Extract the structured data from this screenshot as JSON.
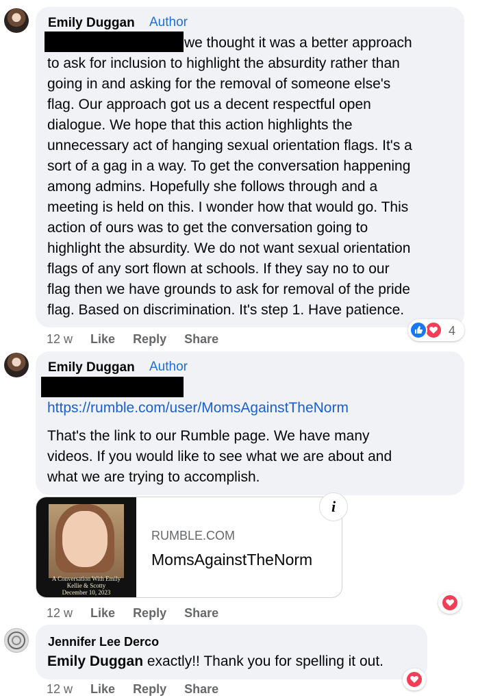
{
  "comments": [
    {
      "author": "Emily Duggan",
      "badge": "Author",
      "lines": [
        "we thought it was a better approach",
        "to ask for inclusion to highlight the absurdity rather than",
        "going in and asking for the removal of someone else's",
        "flag. Our approach got us a decent respectful open",
        "dialogue. We hope that this action highlights the",
        "unnecessary act of hanging sexual orientation flags. It's a",
        "sort of a gag in a way. To get the conversation happening",
        "among admins. Hopefully she follows through and a",
        "meeting is held on this. I wonder how that would go. This",
        "action of ours was to get the conversation going to",
        "highlight the absurdity. We do not want sexual orientation",
        "flags of any sort flown at schools. If they say no to our",
        "flag then we have grounds to ask for removal of the pride",
        "flag. Based on discrimination. It's step 1. Have patience."
      ],
      "time": "12 w",
      "like": "Like",
      "reply": "Reply",
      "share": "Share",
      "reaction_count": "4",
      "reactions": [
        "like-icon",
        "love-icon"
      ]
    },
    {
      "author": "Emily Duggan",
      "badge": "Author",
      "link": "https://rumble.com/user/MomsAgainstTheNorm",
      "lines": [
        "That's the link to our Rumble page. We have many",
        "videos. If you would like to see what we are about and",
        "what we are trying to accomplish."
      ],
      "card": {
        "domain": "RUMBLE.COM",
        "title": "MomsAgainstTheNorm",
        "thumb_caption": [
          "A Conversation With Emily",
          "Kellie & Scotty",
          "December 10, 2023"
        ],
        "info_glyph": "i"
      },
      "time": "12 w",
      "like": "Like",
      "reply": "Reply",
      "share": "Share",
      "reactions": [
        "love-icon"
      ]
    },
    {
      "author": "Jennifer Lee Derco",
      "mention": "Emily Duggan",
      "text": " exactly!! Thank you for spelling it out.",
      "time": "12 w",
      "like": "Like",
      "reply": "Reply",
      "share": "Share",
      "reactions": [
        "love-icon"
      ]
    }
  ],
  "colors": {
    "bubble": "#f0f2f5",
    "link": "#1a5fd0",
    "author_badge": "#1a6fd8",
    "meta": "#65676b",
    "like_blue": "#1877f2",
    "love_red": "#f33e58"
  }
}
